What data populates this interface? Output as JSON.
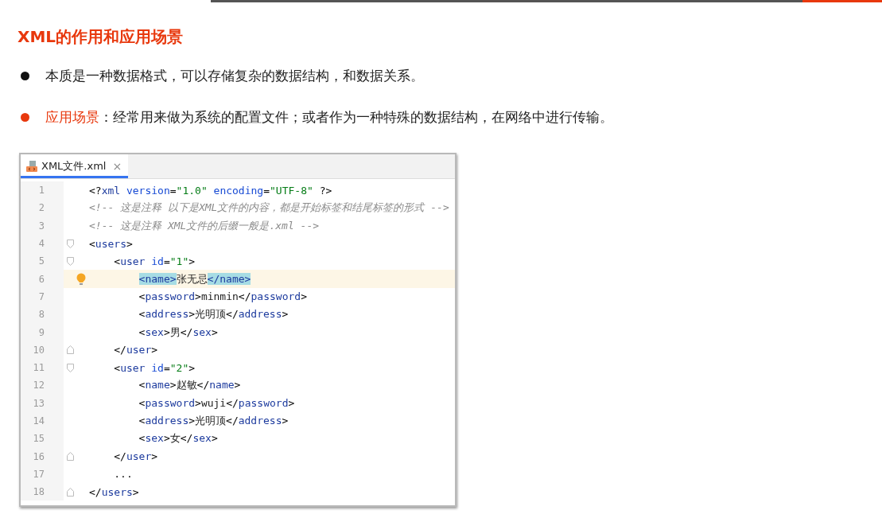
{
  "title": "XML的作用和应用场景",
  "bullets": [
    {
      "color": "#111111",
      "text": "本质是一种数据格式，可以存储复杂的数据结构，和数据关系。"
    },
    {
      "color": "#e8380d",
      "highlight": "应用场景",
      "text": "：经常用来做为系统的配置文件；或者作为一种特殊的数据结构，在网络中进行传输。"
    }
  ],
  "editor": {
    "tabs": [
      {
        "label": "XML文件.xml",
        "close": "×",
        "selected": true
      }
    ],
    "lines": [
      {
        "number": "1",
        "segments": [
          {
            "kind": "punct",
            "text": "<?"
          },
          {
            "kind": "tag",
            "text": "xml"
          },
          {
            "kind": "attr",
            "text": " version"
          },
          {
            "kind": "punct",
            "text": "="
          },
          {
            "kind": "string",
            "text": "\"1.0\""
          },
          {
            "kind": "attr",
            "text": " encoding"
          },
          {
            "kind": "punct",
            "text": "="
          },
          {
            "kind": "string",
            "text": "\"UTF-8\""
          },
          {
            "kind": "punct",
            "text": " ?>"
          }
        ]
      },
      {
        "number": "2",
        "segments": [
          {
            "kind": "comment",
            "text": "<!-- 这是注释 以下是XML文件的内容，都是开始标签和结尾标签的形式 -->"
          }
        ]
      },
      {
        "number": "3",
        "segments": [
          {
            "kind": "comment",
            "text": "<!-- 这是注释 XML文件的后缀一般是.xml -->"
          }
        ]
      },
      {
        "number": "4",
        "fold_start": true,
        "segments": [
          {
            "kind": "punct",
            "text": "<"
          },
          {
            "kind": "tag",
            "text": "users"
          },
          {
            "kind": "punct",
            "text": ">"
          }
        ],
        "children": [
          {
            "number": "5",
            "fold_start": true,
            "segments": [
              {
                "kind": "punct",
                "text": "<"
              },
              {
                "kind": "tag",
                "text": "user"
              },
              {
                "kind": "attr",
                "text": " id"
              },
              {
                "kind": "punct",
                "text": "="
              },
              {
                "kind": "string",
                "text": "\"1\""
              },
              {
                "kind": "punct",
                "text": ">"
              }
            ],
            "children": [
              {
                "number": "6",
                "current": true,
                "segments": [
                  {
                    "kind": "match",
                    "text": "<name>"
                  },
                  {
                    "kind": "text",
                    "text": "张无忌"
                  },
                  {
                    "kind": "match",
                    "text": "</name>"
                  }
                ]
              },
              {
                "number": "7",
                "segments": [
                  {
                    "kind": "punct",
                    "text": "<"
                  },
                  {
                    "kind": "tag",
                    "text": "password"
                  },
                  {
                    "kind": "punct",
                    "text": ">"
                  },
                  {
                    "kind": "text",
                    "text": "minmin"
                  },
                  {
                    "kind": "punct",
                    "text": "</"
                  },
                  {
                    "kind": "tag",
                    "text": "password"
                  },
                  {
                    "kind": "punct",
                    "text": ">"
                  }
                ]
              },
              {
                "number": "8",
                "segments": [
                  {
                    "kind": "punct",
                    "text": "<"
                  },
                  {
                    "kind": "tag",
                    "text": "address"
                  },
                  {
                    "kind": "punct",
                    "text": ">"
                  },
                  {
                    "kind": "text",
                    "text": "光明顶"
                  },
                  {
                    "kind": "punct",
                    "text": "</"
                  },
                  {
                    "kind": "tag",
                    "text": "address"
                  },
                  {
                    "kind": "punct",
                    "text": ">"
                  }
                ]
              },
              {
                "number": "9",
                "segments": [
                  {
                    "kind": "punct",
                    "text": "<"
                  },
                  {
                    "kind": "tag",
                    "text": "sex"
                  },
                  {
                    "kind": "punct",
                    "text": ">"
                  },
                  {
                    "kind": "text",
                    "text": "男"
                  },
                  {
                    "kind": "punct",
                    "text": "</"
                  },
                  {
                    "kind": "tag",
                    "text": "sex"
                  },
                  {
                    "kind": "punct",
                    "text": ">"
                  }
                ]
              }
            ]
          },
          {
            "number": "10",
            "fold_end": true,
            "segments": [
              {
                "kind": "punct",
                "text": "</"
              },
              {
                "kind": "tag",
                "text": "user"
              },
              {
                "kind": "punct",
                "text": ">"
              }
            ]
          },
          {
            "number": "11",
            "fold_start": true,
            "segments": [
              {
                "kind": "punct",
                "text": "<"
              },
              {
                "kind": "tag",
                "text": "user"
              },
              {
                "kind": "attr",
                "text": " id"
              },
              {
                "kind": "punct",
                "text": "="
              },
              {
                "kind": "string",
                "text": "\"2\""
              },
              {
                "kind": "punct",
                "text": ">"
              }
            ],
            "children": [
              {
                "number": "12",
                "segments": [
                  {
                    "kind": "punct",
                    "text": "<"
                  },
                  {
                    "kind": "tag",
                    "text": "name"
                  },
                  {
                    "kind": "punct",
                    "text": ">"
                  },
                  {
                    "kind": "text",
                    "text": "赵敏"
                  },
                  {
                    "kind": "punct",
                    "text": "</"
                  },
                  {
                    "kind": "tag",
                    "text": "name"
                  },
                  {
                    "kind": "punct",
                    "text": ">"
                  }
                ]
              },
              {
                "number": "13",
                "segments": [
                  {
                    "kind": "punct",
                    "text": "<"
                  },
                  {
                    "kind": "tag",
                    "text": "password"
                  },
                  {
                    "kind": "punct",
                    "text": ">"
                  },
                  {
                    "kind": "text",
                    "text": "wuji"
                  },
                  {
                    "kind": "punct",
                    "text": "</"
                  },
                  {
                    "kind": "tag",
                    "text": "password"
                  },
                  {
                    "kind": "punct",
                    "text": ">"
                  }
                ]
              },
              {
                "number": "14",
                "segments": [
                  {
                    "kind": "punct",
                    "text": "<"
                  },
                  {
                    "kind": "tag",
                    "text": "address"
                  },
                  {
                    "kind": "punct",
                    "text": ">"
                  },
                  {
                    "kind": "text",
                    "text": "光明顶"
                  },
                  {
                    "kind": "punct",
                    "text": "</"
                  },
                  {
                    "kind": "tag",
                    "text": "address"
                  },
                  {
                    "kind": "punct",
                    "text": ">"
                  }
                ]
              },
              {
                "number": "15",
                "segments": [
                  {
                    "kind": "punct",
                    "text": "<"
                  },
                  {
                    "kind": "tag",
                    "text": "sex"
                  },
                  {
                    "kind": "punct",
                    "text": ">"
                  },
                  {
                    "kind": "text",
                    "text": "女"
                  },
                  {
                    "kind": "punct",
                    "text": "</"
                  },
                  {
                    "kind": "tag",
                    "text": "sex"
                  },
                  {
                    "kind": "punct",
                    "text": ">"
                  }
                ]
              }
            ]
          },
          {
            "number": "16",
            "fold_end": true,
            "segments": [
              {
                "kind": "punct",
                "text": "</"
              },
              {
                "kind": "tag",
                "text": "user"
              },
              {
                "kind": "punct",
                "text": ">"
              }
            ]
          },
          {
            "number": "17",
            "segments": [
              {
                "kind": "punct",
                "text": "..."
              }
            ]
          }
        ]
      },
      {
        "number": "18",
        "fold_end": true,
        "segments": [
          {
            "kind": "punct",
            "text": "</"
          },
          {
            "kind": "tag",
            "text": "users"
          },
          {
            "kind": "punct",
            "text": ">"
          }
        ]
      }
    ]
  }
}
